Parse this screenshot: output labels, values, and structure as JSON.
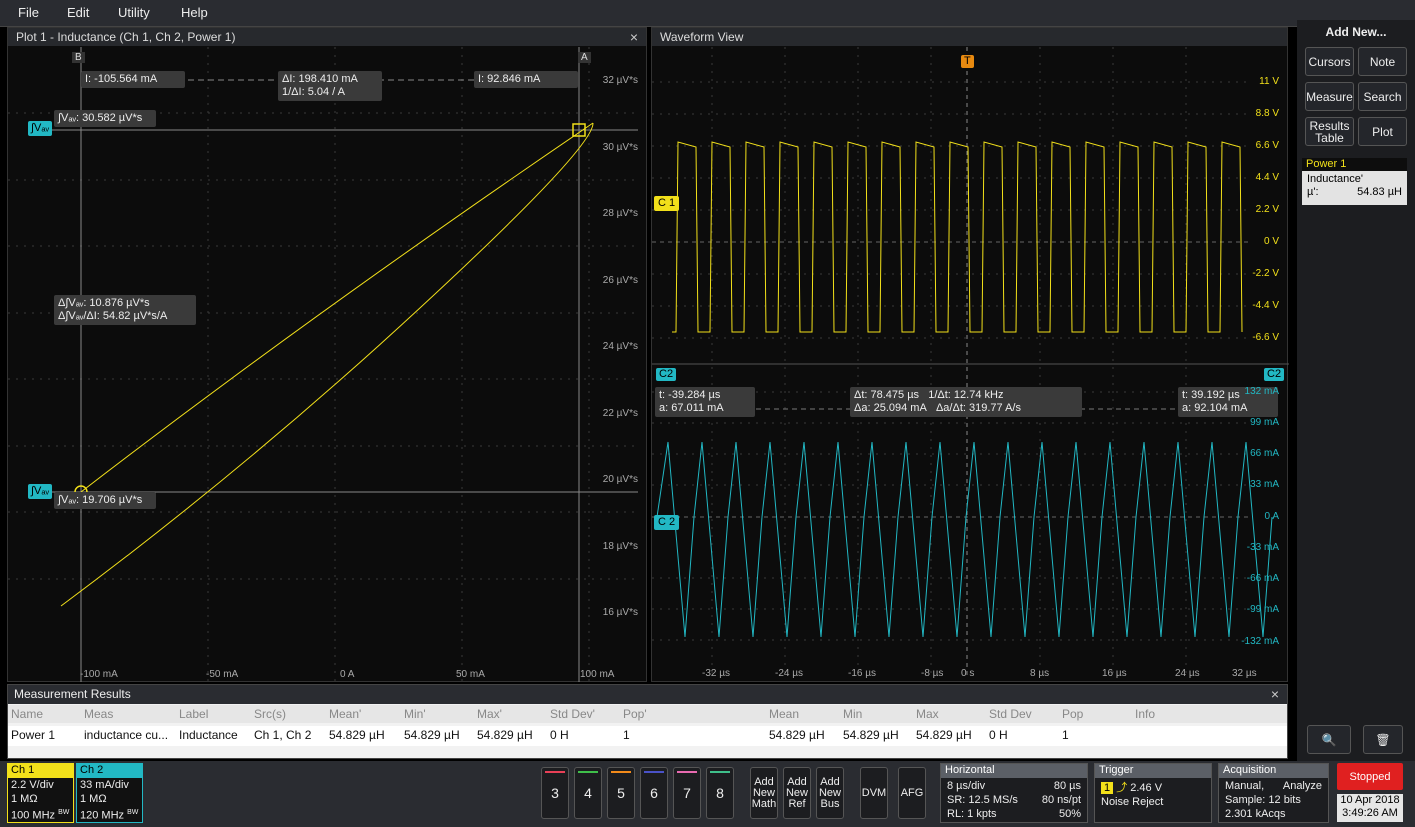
{
  "menu": [
    "File",
    "Edit",
    "Utility",
    "Help"
  ],
  "plot1": {
    "title": "Plot 1 - Inductance (Ch 1, Ch 2, Power 1)",
    "close": "×",
    "cursor_a_marker": "A",
    "cursor_b_marker": "B",
    "i_a": "I: 92.846 mA",
    "i_b": "I: -105.564 mA",
    "delta_i": "ΔI: 198.410 mA",
    "inv_delta_i": "1/ΔI: 5.04 / A",
    "int_a": "∫Vₐᵥ: 30.582 µV*s",
    "int_b": "∫Vₐᵥ: 19.706 µV*s",
    "int_tag": "∫Vₐᵥ",
    "delta_int": "Δ∫Vₐᵥ: 10.876 µV*s",
    "delta_ratio": "Δ∫Vₐᵥ/ΔI: 54.82 µV*s/A",
    "y_ticks": [
      "32 µV*s",
      "30 µV*s",
      "28 µV*s",
      "26 µV*s",
      "24 µV*s",
      "22 µV*s",
      "20 µV*s",
      "18 µV*s",
      "16 µV*s"
    ],
    "x_ticks": [
      "-100 mA",
      "-50 mA",
      "0 A",
      "50 mA",
      "100 mA"
    ]
  },
  "wave": {
    "title": "Waveform View",
    "c1_label": "C 1",
    "c2_label": "C 2",
    "c2_tag": "C2",
    "ch1_ticks": [
      "11 V",
      "8.8 V",
      "6.6 V",
      "4.4 V",
      "2.2 V",
      "0 V",
      "-2.2 V",
      "-4.4 V",
      "-6.6 V"
    ],
    "ch2_ticks": [
      "132 mA",
      "99 mA",
      "66 mA",
      "33 mA",
      "0 A",
      "-33 mA",
      "-66 mA",
      "-99 mA",
      "-132 mA"
    ],
    "time_ticks": [
      "-32 µs",
      "-24 µs",
      "-16 µs",
      "-8 µs",
      "0 s",
      "8 µs",
      "16 µs",
      "24 µs",
      "32 µs"
    ],
    "cursor_t1": "t: -39.284 µs",
    "cursor_a1": "a: 67.011 mA",
    "cursor_dt": "Δt: 78.475 µs",
    "cursor_invdt": "1/Δt: 12.74 kHz",
    "cursor_da": "Δa: 25.094 mA",
    "cursor_dadt": "Δa/Δt: 319.77 A/s",
    "cursor_t2": "t: 39.192 µs",
    "cursor_a2": "a: 92.104 mA",
    "trigger_marker": "T"
  },
  "side": {
    "title": "Add New...",
    "buttons": [
      "Cursors",
      "Note",
      "Measure",
      "Search",
      "Results Table",
      "Plot"
    ],
    "badge_title": "Power 1",
    "badge_line1": "Inductance'",
    "badge_line2_label": "µ':",
    "badge_line2_value": "54.83 µH"
  },
  "meas": {
    "title": "Measurement Results",
    "headers": [
      "Name",
      "Meas",
      "Label",
      "Src(s)",
      "Mean'",
      "Min'",
      "Max'",
      "Std Dev'",
      "Pop'",
      "Mean",
      "Min",
      "Max",
      "Std Dev",
      "Pop",
      "Info"
    ],
    "row": [
      "Power 1",
      "inductance cu...",
      "Inductance",
      "Ch 1, Ch 2",
      "54.829 µH",
      "54.829 µH",
      "54.829 µH",
      "0 H",
      "1",
      "54.829 µH",
      "54.829 µH",
      "54.829 µH",
      "0 H",
      "1",
      ""
    ]
  },
  "bottom": {
    "ch1": {
      "name": "Ch 1",
      "l1": "2.2 V/div",
      "l2": "1 MΩ",
      "l3": "100 MHz",
      "bw": "BW"
    },
    "ch2": {
      "name": "Ch 2",
      "l1": "33 mA/div",
      "l2": "1 MΩ",
      "l3": "120 MHz",
      "bw": "BW"
    },
    "num_buttons": [
      "3",
      "4",
      "5",
      "6",
      "7",
      "8"
    ],
    "num_colors": [
      "#e84057",
      "#3fbf4a",
      "#f28a1a",
      "#4a52c8",
      "#e86ab0",
      "#3fbf8a"
    ],
    "add_math": "Add New Math",
    "add_ref": "Add New Ref",
    "add_bus": "Add New Bus",
    "dvm": "DVM",
    "afg": "AFG",
    "horizontal": {
      "title": "Horizontal",
      "l1a": "8 µs/div",
      "l1b": "80 µs",
      "l2a": "SR: 12.5 MS/s",
      "l2b": "80 ns/pt",
      "l3a": "RL: 1 kpts",
      "l3b": "50%"
    },
    "trigger": {
      "title": "Trigger",
      "ch": "1",
      "level": "2.46 V",
      "mode": "Noise Reject"
    },
    "acq": {
      "title": "Acquisition",
      "l1a": "Manual,",
      "l1b": "Analyze",
      "l2": "Sample: 12 bits",
      "l3": "2.301 kAcqs"
    },
    "stopped": "Stopped",
    "date": "10 Apr 2018",
    "time": "3:49:26 AM"
  },
  "colors": {
    "ch1": "#f2e01a",
    "ch2": "#22b8c4",
    "accent": "#e02020"
  }
}
